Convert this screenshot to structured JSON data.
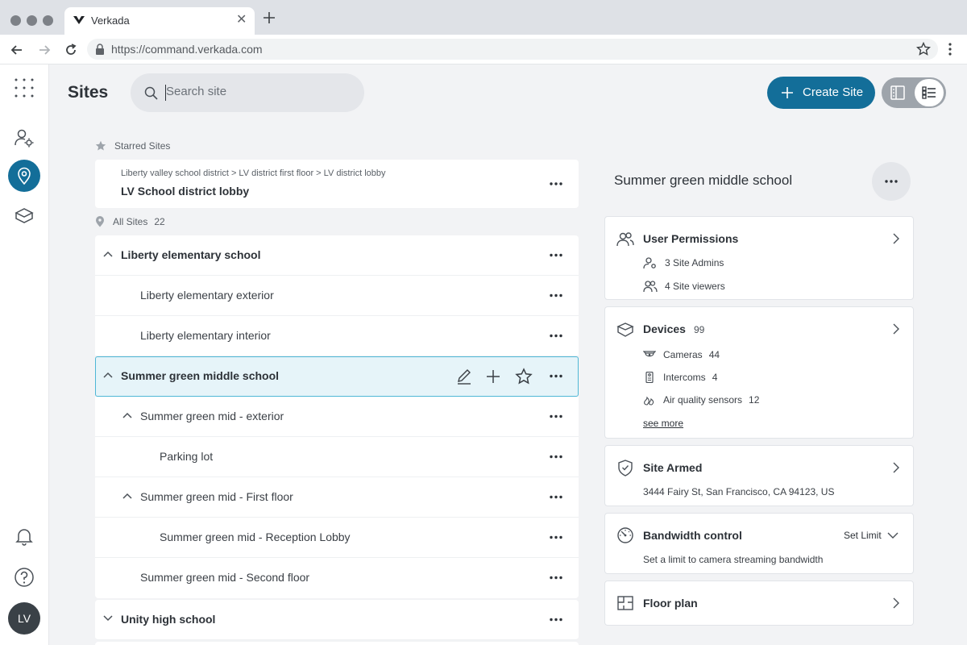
{
  "browser": {
    "tab_title": "Verkada",
    "url": "https://command.verkada.com"
  },
  "rail": {
    "avatar_initials": "LV"
  },
  "header": {
    "title": "Sites",
    "search_placeholder": "Search site",
    "create_label": "Create Site"
  },
  "starred": {
    "label": "Starred Sites",
    "crumbs": "Liberty valley school district > LV district first floor > LV district lobby",
    "name": "LV School district lobby"
  },
  "all_sites": {
    "label": "All Sites",
    "count": "22"
  },
  "tree": {
    "liberty": "Liberty elementary school",
    "liberty_exterior": "Liberty elementary exterior",
    "liberty_interior": "Liberty elementary interior",
    "summer": "Summer green middle school",
    "summer_exterior": "Summer green mid - exterior",
    "parking": "Parking lot",
    "summer_first": "Summer green mid - First floor",
    "reception": "Summer green mid - Reception Lobby",
    "summer_second": "Summer green mid - Second floor",
    "unity": "Unity high school"
  },
  "panel": {
    "title": "Summer green middle school",
    "user_permissions": {
      "title": "User Permissions",
      "admins": "3 Site Admins",
      "viewers": "4 Site viewers"
    },
    "devices": {
      "title": "Devices",
      "count": "99",
      "cameras_label": "Cameras",
      "cameras_count": "44",
      "intercoms_label": "Intercoms",
      "intercoms_count": "4",
      "air_label": "Air quality sensors",
      "air_count": "12",
      "see_more": "see more"
    },
    "site_armed": {
      "title": "Site Armed",
      "address": "3444 Fairy St, San Francisco, CA 94123, US"
    },
    "bandwidth": {
      "title": "Bandwidth control",
      "set_limit": "Set Limit",
      "description": "Set a limit to camera streaming bandwidth"
    },
    "floor_plan": {
      "title": "Floor plan"
    }
  },
  "colors": {
    "accent": "#136e99",
    "selected_row_bg": "#e6f4f9",
    "selected_row_border": "#4fb7d6"
  }
}
